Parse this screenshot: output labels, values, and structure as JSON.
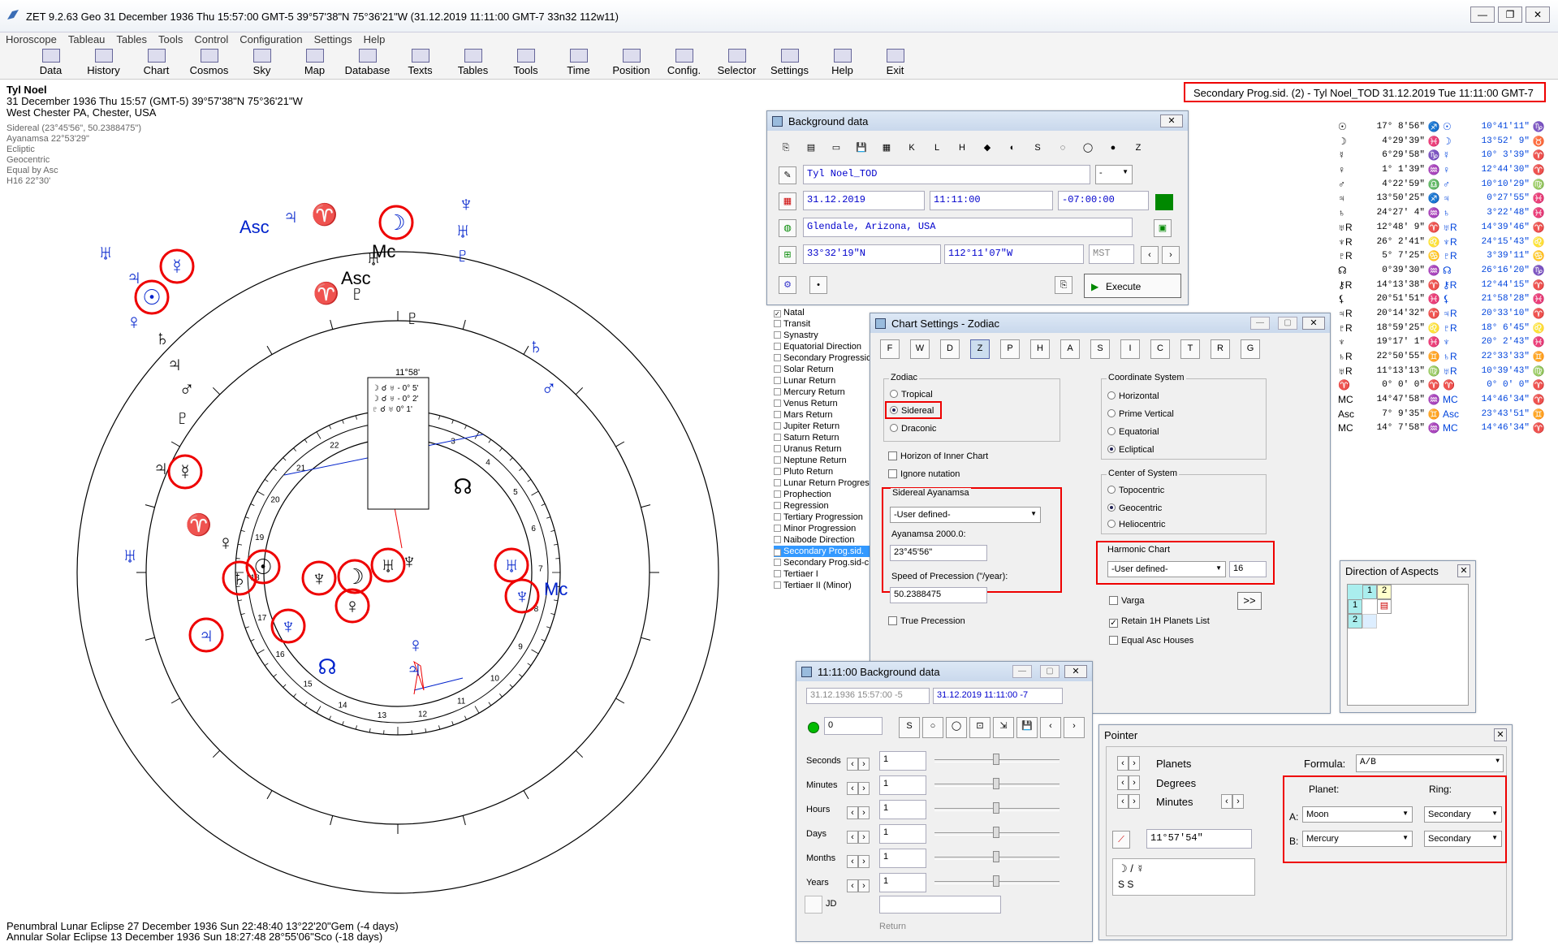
{
  "window": {
    "title": "ZET 9.2.63 Geo   31 December 1936  Thu   15:57:00 GMT-5 39°57'38\"N  75°36'21\"W   (31.12.2019  11:11:00 GMT-7 33n32 112w11)"
  },
  "menu": [
    "Horoscope",
    "Tableau",
    "Tables",
    "Tools",
    "Control",
    "Configuration",
    "Settings",
    "Help"
  ],
  "toolbar": [
    "Data",
    "History",
    "Chart",
    "Cosmos",
    "Sky",
    "Map",
    "Database",
    "Texts",
    "Tables",
    "Tools",
    "Time",
    "Position",
    "Config.",
    "Selector",
    "Settings",
    "Help",
    "Exit"
  ],
  "header": {
    "name": "Tyl Noel",
    "line1": "31 December 1936  Thu  15:57 (GMT-5) 39°57'38\"N  75°36'21\"W",
    "line2": "West Chester PA, Chester, USA"
  },
  "settings_summary": [
    "Sidereal (23°45'56\", 50.2388475\")",
    "Ayanamsa 22°53'29\"",
    "Ecliptic",
    "Geocentric",
    "Equal by Asc",
    "H16  22°30'"
  ],
  "eclipses": [
    "Penumbral Lunar Eclipse 27 December 1936 Sun 22:48:40 13°22'20\"Gem (-4 days)",
    "Annular Solar Eclipse 13 December 1936 Sun 18:27:48 28°55'06\"Sco (-18 days)"
  ],
  "top_label": "Secondary Prog.sid. (2) - Tyl Noel_TOD 31.12.2019  Tue 11:11:00 GMT-7",
  "chart": {
    "center_angle": "11°58'",
    "aspects": [
      "☽ ☌ ♅ - 0° 5'",
      "☽ ☌ ♅ - 0° 2'",
      "♇ ☌ ♅  0° 1'"
    ],
    "inner_house_numbers": [
      "1",
      "2",
      "3",
      "4",
      "5",
      "6",
      "7",
      "8",
      "9",
      "10",
      "11",
      "12",
      "13",
      "14",
      "15",
      "16",
      "17",
      "18",
      "19",
      "20",
      "21",
      "22"
    ],
    "outer_labels": [
      "Asc",
      "Mc"
    ],
    "inner_labels": [
      "Asc",
      "Mc"
    ],
    "colors": {
      "natal": "#000000",
      "progressed": "#0022cc",
      "highlight": "#e00000"
    }
  },
  "bg_window": {
    "title": "Background data",
    "name": "Tyl Noel_TOD",
    "name_opt": "-",
    "date": "31.12.2019",
    "time": "11:11:00",
    "tz": "-07:00:00",
    "place": "Glendale, Arizona, USA",
    "lat": "33°32'19\"N",
    "lon": "112°11'07\"W",
    "zone": "MST",
    "execute": "Execute"
  },
  "chart_types": [
    {
      "t": "Natal",
      "c": true
    },
    {
      "t": "Transit"
    },
    {
      "t": "Synastry"
    },
    {
      "t": "Equatorial Direction"
    },
    {
      "t": "Secondary Progression"
    },
    {
      "t": "Solar Return"
    },
    {
      "t": "Lunar Return"
    },
    {
      "t": "Mercury Return"
    },
    {
      "t": "Venus Return"
    },
    {
      "t": "Mars Return"
    },
    {
      "t": "Jupiter Return"
    },
    {
      "t": "Saturn Return"
    },
    {
      "t": "Uranus Return"
    },
    {
      "t": "Neptune Return"
    },
    {
      "t": "Pluto Return"
    },
    {
      "t": "Lunar Return Progress"
    },
    {
      "t": "Prophection"
    },
    {
      "t": "Regression"
    },
    {
      "t": "Tertiary Progression"
    },
    {
      "t": "Minor Progression"
    },
    {
      "t": "Naibode Direction"
    },
    {
      "t": "Secondary Prog.sid.",
      "c": true,
      "sel": true
    },
    {
      "t": "Secondary Prog.sid-c"
    },
    {
      "t": "Tertiaer I"
    },
    {
      "t": "Tertiaer II (Minor)"
    }
  ],
  "cs_window": {
    "title": "Chart Settings - Zodiac",
    "zodiac": "Zodiac",
    "tropical": "Tropical",
    "sidereal": "Sidereal",
    "draconic": "Draconic",
    "horizon": "Horizon of Inner Chart",
    "ignore": "Ignore nutation",
    "ayan_group": "Sidereal Ayanamsa",
    "ayan_sel": "-User defined-",
    "ayan_label": "Ayanamsa 2000.0:",
    "ayan_val": "23°45'56\"",
    "speed_label": "Speed of Precession (\"/year):",
    "speed_val": "50.2388475",
    "true_prec": "True Precession",
    "coord": "Coordinate System",
    "horizontal": "Horizontal",
    "prime": "Prime Vertical",
    "equatorial": "Equatorial",
    "ecliptical": "Ecliptical",
    "center": "Center of System",
    "topo": "Topocentric",
    "geo": "Geocentric",
    "helio": "Heliocentric",
    "harm": "Harmonic Chart",
    "harm_sel": "-User defined-",
    "harm_val": "16",
    "varga": "Varga",
    "more": ">>",
    "retain": "Retain 1H Planets List",
    "equal": "Equal Asc Houses"
  },
  "bg2_window": {
    "title": "11:11:00 Background data",
    "d1": "31.12.1936  15:57:00  -5",
    "d2": "31.12.2019   11:11:00  -7",
    "step": "0",
    "rows": [
      {
        "l": "Seconds",
        "v": "1"
      },
      {
        "l": "Minutes",
        "v": "1"
      },
      {
        "l": "Hours",
        "v": "1"
      },
      {
        "l": "Days",
        "v": "1"
      },
      {
        "l": "Months",
        "v": "1"
      },
      {
        "l": "Years",
        "v": "1"
      }
    ],
    "jd": "JD",
    "ret": "Return"
  },
  "doa_window": {
    "title": "Direction of Aspects",
    "h1": "1",
    "h2": "2",
    "r1": "1",
    "r2": "2"
  },
  "pointer_window": {
    "title": "Pointer",
    "planets": "Planets",
    "degrees": "Degrees",
    "minutes": "Minutes",
    "formula_l": "Formula:",
    "formula": "A/B",
    "planet_l": "Planet:",
    "ring_l": "Ring:",
    "a": "A:",
    "b": "B:",
    "pa": "Moon",
    "pb": "Mercury",
    "ra": "Secondary",
    "rb": "Secondary",
    "value": "11°57'54\"",
    "result": "☽ / ☿",
    "ss": "S   S"
  },
  "planet_table": [
    [
      "☉",
      "17° 8'56\"",
      "♐",
      "☉",
      "10°41'11\"",
      "♑"
    ],
    [
      "☽",
      "4°29'39\"",
      "♓",
      "☽",
      "13°52' 9\"",
      "♉"
    ],
    [
      "☿",
      "6°29'58\"",
      "♑",
      "☿",
      "10° 3'39\"",
      "♈"
    ],
    [
      "♀",
      "1° 1'39\"",
      "♒",
      "♀",
      "12°44'30\"",
      "♈"
    ],
    [
      "♂",
      "4°22'59\"",
      "♎",
      "♂",
      "10°10'29\"",
      "♍"
    ],
    [
      "♃",
      "13°50'25\"",
      "♐",
      "♃",
      "0°27'55\"",
      "♓"
    ],
    [
      "♄",
      "24°27' 4\"",
      "♒",
      "♄",
      "3°22'48\"",
      "♓"
    ],
    [
      "♅R",
      "12°48' 9\"",
      "♈",
      "♅R",
      "14°39'46\"",
      "♈"
    ],
    [
      "♆R",
      "26° 2'41\"",
      "♌",
      "♆R",
      "24°15'43\"",
      "♌"
    ],
    [
      "♇R",
      "5° 7'25\"",
      "♋",
      "♇R",
      "3°39'11\"",
      "♋"
    ],
    [
      "☊",
      "0°39'30\"",
      "♒",
      "☊",
      "26°16'20\"",
      "♑"
    ],
    [
      "⚷R",
      "14°13'38\"",
      "♈",
      "⚷R",
      "12°44'15\"",
      "♈"
    ],
    [
      "⚸",
      "20°51'51\"",
      "♓",
      "⚸",
      "21°58'28\"",
      "♓"
    ],
    [
      "♃R",
      "20°14'32\"",
      "♈",
      "♃R",
      "20°33'10\"",
      "♈"
    ],
    [
      "♇R",
      "18°59'25\"",
      "♌",
      "♇R",
      "18° 6'45\"",
      "♌"
    ],
    [
      "♆",
      "19°17' 1\"",
      "♓",
      "♆",
      "20° 2'43\"",
      "♓"
    ],
    [
      "♄R",
      "22°50'55\"",
      "♊",
      "♄R",
      "22°33'33\"",
      "♊"
    ],
    [
      "♅R",
      "11°13'13\"",
      "♍",
      "♅R",
      "10°39'43\"",
      "♍"
    ],
    [
      "♈",
      "0° 0' 0\"",
      "♈",
      "♈",
      "0° 0' 0\"",
      "♈"
    ],
    [
      "MC",
      "14°47'58\"",
      "♒",
      "MC",
      "14°46'34\"",
      "♈"
    ],
    [
      "Asc",
      "7° 9'35\"",
      "♊",
      "Asc",
      "23°43'51\"",
      "♊"
    ],
    [
      "MC",
      "14° 7'58\"",
      "♒",
      "MC",
      "14°46'34\"",
      "♈"
    ]
  ]
}
